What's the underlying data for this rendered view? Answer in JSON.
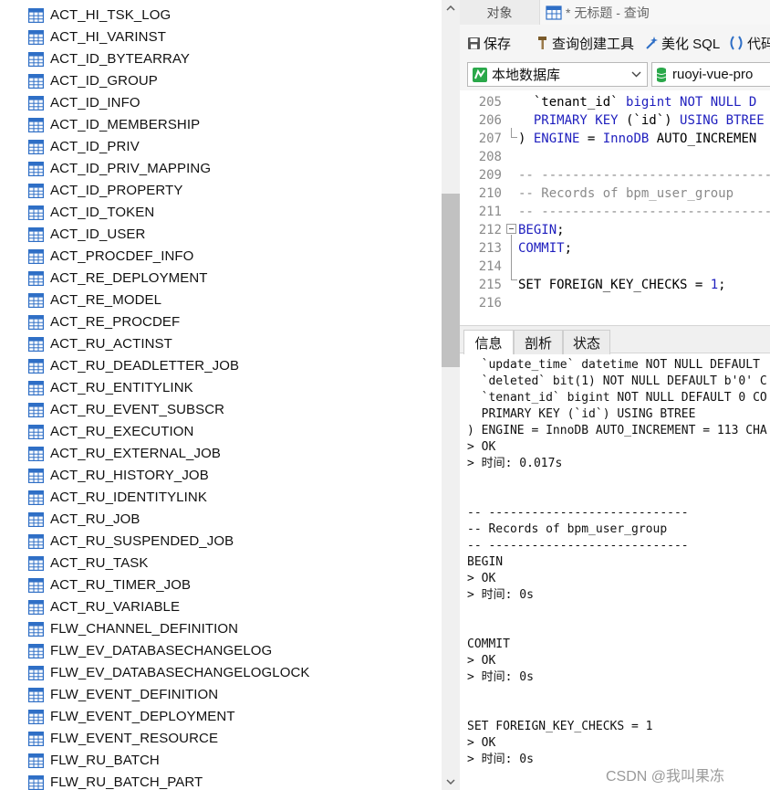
{
  "tables": [
    "ACT_HI_TSK_LOG",
    "ACT_HI_VARINST",
    "ACT_ID_BYTEARRAY",
    "ACT_ID_GROUP",
    "ACT_ID_INFO",
    "ACT_ID_MEMBERSHIP",
    "ACT_ID_PRIV",
    "ACT_ID_PRIV_MAPPING",
    "ACT_ID_PROPERTY",
    "ACT_ID_TOKEN",
    "ACT_ID_USER",
    "ACT_PROCDEF_INFO",
    "ACT_RE_DEPLOYMENT",
    "ACT_RE_MODEL",
    "ACT_RE_PROCDEF",
    "ACT_RU_ACTINST",
    "ACT_RU_DEADLETTER_JOB",
    "ACT_RU_ENTITYLINK",
    "ACT_RU_EVENT_SUBSCR",
    "ACT_RU_EXECUTION",
    "ACT_RU_EXTERNAL_JOB",
    "ACT_RU_HISTORY_JOB",
    "ACT_RU_IDENTITYLINK",
    "ACT_RU_JOB",
    "ACT_RU_SUSPENDED_JOB",
    "ACT_RU_TASK",
    "ACT_RU_TIMER_JOB",
    "ACT_RU_VARIABLE",
    "FLW_CHANNEL_DEFINITION",
    "FLW_EV_DATABASECHANGELOG",
    "FLW_EV_DATABASECHANGELOGLOCK",
    "FLW_EVENT_DEFINITION",
    "FLW_EVENT_DEPLOYMENT",
    "FLW_EVENT_RESOURCE",
    "FLW_RU_BATCH",
    "FLW_RU_BATCH_PART"
  ],
  "tabs": {
    "objects": "对象",
    "query": "* 无标题 - 查询"
  },
  "toolbar": {
    "save": "保存",
    "query_builder": "查询创建工具",
    "beautify": "美化 SQL",
    "code": "代码"
  },
  "selectors": {
    "connection": "本地数据库",
    "database": "ruoyi-vue-pro"
  },
  "editor": {
    "lines": [
      {
        "num": "205",
        "parts": [
          {
            "t": "  `tenant_id` ",
            "c": ""
          },
          {
            "t": "bigint NOT NULL D",
            "c": "kw"
          }
        ]
      },
      {
        "num": "206",
        "parts": [
          {
            "t": "  ",
            "c": ""
          },
          {
            "t": "PRIMARY KEY",
            "c": "kw"
          },
          {
            "t": " (`id`) ",
            "c": ""
          },
          {
            "t": "USING BTREE",
            "c": "kw"
          }
        ]
      },
      {
        "num": "207",
        "parts": [
          {
            "t": ") ",
            "c": ""
          },
          {
            "t": "ENGINE",
            "c": "kw"
          },
          {
            "t": " = ",
            "c": ""
          },
          {
            "t": "InnoDB",
            "c": "kw"
          },
          {
            "t": " AUTO_INCREMEN",
            "c": ""
          }
        ]
      },
      {
        "num": "208",
        "parts": []
      },
      {
        "num": "209",
        "parts": [
          {
            "t": "-- ------------------------------",
            "c": "cm"
          }
        ]
      },
      {
        "num": "210",
        "parts": [
          {
            "t": "-- Records of bpm_user_group",
            "c": "cm"
          }
        ]
      },
      {
        "num": "211",
        "parts": [
          {
            "t": "-- ------------------------------",
            "c": "cm"
          }
        ]
      },
      {
        "num": "212",
        "parts": [
          {
            "t": "BEGIN",
            "c": "kw"
          },
          {
            "t": ";",
            "c": ""
          }
        ]
      },
      {
        "num": "213",
        "parts": [
          {
            "t": "COMMIT",
            "c": "kw"
          },
          {
            "t": ";",
            "c": ""
          }
        ]
      },
      {
        "num": "214",
        "parts": []
      },
      {
        "num": "215",
        "parts": [
          {
            "t": "SET FOREIGN_KEY_CHECKS = ",
            "c": ""
          },
          {
            "t": "1",
            "c": "num"
          },
          {
            "t": ";",
            "c": ""
          }
        ]
      },
      {
        "num": "216",
        "parts": []
      }
    ]
  },
  "result_tabs": [
    "信息",
    "剖析",
    "状态"
  ],
  "messages": [
    "  `update_time` datetime NOT NULL DEFAULT",
    "  `deleted` bit(1) NOT NULL DEFAULT b'0' C",
    "  `tenant_id` bigint NOT NULL DEFAULT 0 CO",
    "  PRIMARY KEY (`id`) USING BTREE",
    ") ENGINE = InnoDB AUTO_INCREMENT = 113 CHA",
    "> OK",
    "> 时间: 0.017s",
    "",
    "",
    "-- ----------------------------",
    "-- Records of bpm_user_group",
    "-- ----------------------------",
    "BEGIN",
    "> OK",
    "> 时间: 0s",
    "",
    "",
    "COMMIT",
    "> OK",
    "> 时间: 0s",
    "",
    "",
    "SET FOREIGN_KEY_CHECKS = 1",
    "> OK",
    "> 时间: 0s"
  ],
  "watermark": "CSDN @我叫果冻",
  "colors": {
    "keyword": "#1e1ebe",
    "comment": "#8a8a8a",
    "table_icon": "#2f6fc6"
  }
}
